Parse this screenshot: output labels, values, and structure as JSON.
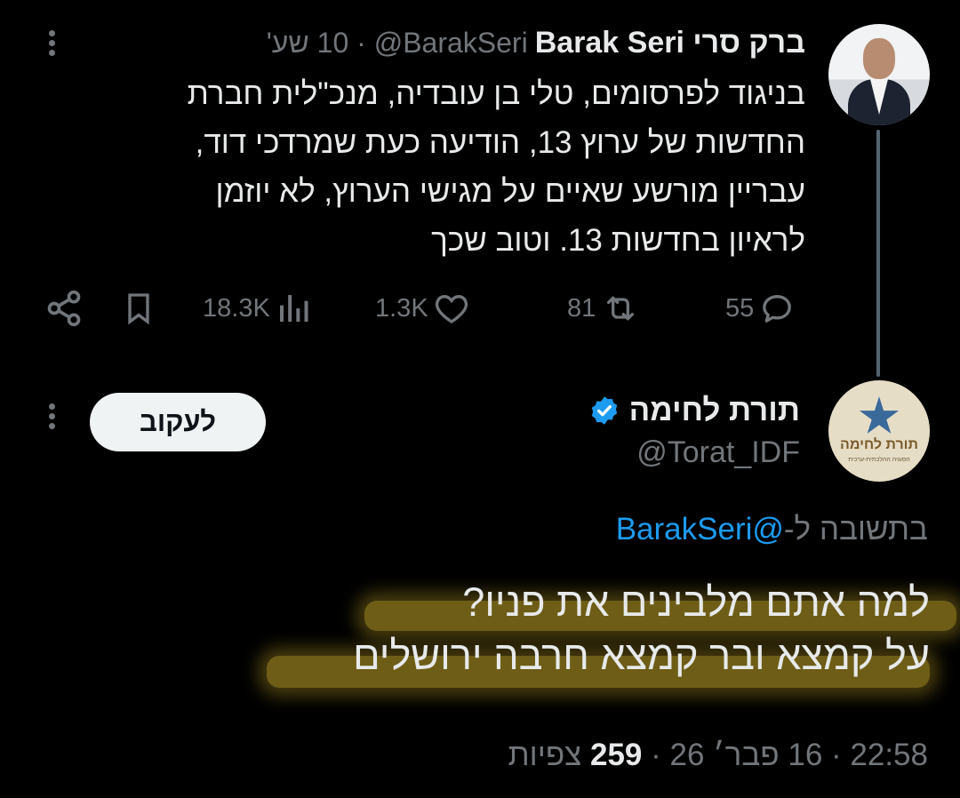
{
  "tweet1": {
    "display_name": "ברק סרי Barak Seri",
    "handle": "@BarakSeri",
    "time_ago": "10 שע'",
    "text_lines": [
      "בניגוד לפרסומים, טלי בן עובדיה, מנכ\"לית חברת",
      "החדשות של ערוץ 13, הודיעה כעת שמרדכי דוד,",
      "עבריין מורשע שאיים על מגישי הערוץ, לא יוזמן",
      "לראיון בחדשות 13. וטוב שכך"
    ],
    "stats": {
      "replies": "55",
      "retweets": "81",
      "likes": "1.3K",
      "views": "18.3K"
    }
  },
  "tweet2": {
    "display_name": "תורת לחימה",
    "handle": "@Torat_IDF",
    "verified": true,
    "follow_label": "לעקוב",
    "reply_prefix": "בתשובה ל-",
    "reply_mention": "@BarakSeri",
    "text_lines": [
      "למה אתם מלבינים את פניו?",
      "על קמצא ובר קמצא חרבה ירושלים"
    ],
    "time": "22:58",
    "date": "16 פבר׳ 26",
    "views_count": "259",
    "views_label": "צפיות",
    "avatar_text": "תורת לחימה",
    "avatar_subtext": "הסוגיה ההלכתית-ערכית"
  },
  "colors": {
    "background": "#000000",
    "text": "#e7e9ea",
    "muted": "#71767b",
    "link": "#1d9bf0",
    "verified": "#1d9bf0",
    "highlight": "#c8aa28"
  }
}
